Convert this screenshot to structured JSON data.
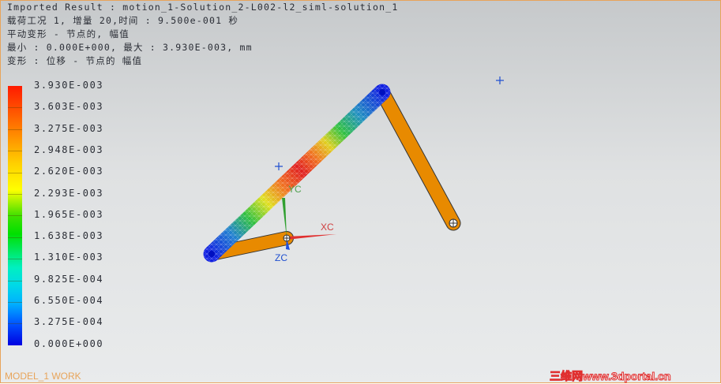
{
  "header": {
    "line1": "Imported Result : motion_1-Solution_2-L002-l2_siml-solution_1",
    "line2": "载荷工况 1, 增量 20,时间 :  9.500e-001 秒",
    "line3": "平动变形 - 节点的, 幅值",
    "line4": "最小 : 0.000E+000, 最大 : 3.930E-003, mm",
    "line5": "变形 : 位移 - 节点的 幅值"
  },
  "legend": {
    "labels": [
      "3.930E-003",
      "3.603E-003",
      "3.275E-003",
      "2.948E-003",
      "2.620E-003",
      "2.293E-003",
      "1.965E-003",
      "1.638E-003",
      "1.310E-003",
      "9.825E-004",
      "6.550E-004",
      "3.275E-004",
      "0.000E+000"
    ]
  },
  "axes": {
    "x": "XC",
    "y": "YC",
    "z": "ZC"
  },
  "footer": {
    "model": "MODEL_1 WORK",
    "watermark": "三维网www.3dportal.cn"
  },
  "colors": {
    "link": "#e88a00",
    "border": "#e8a45a"
  }
}
